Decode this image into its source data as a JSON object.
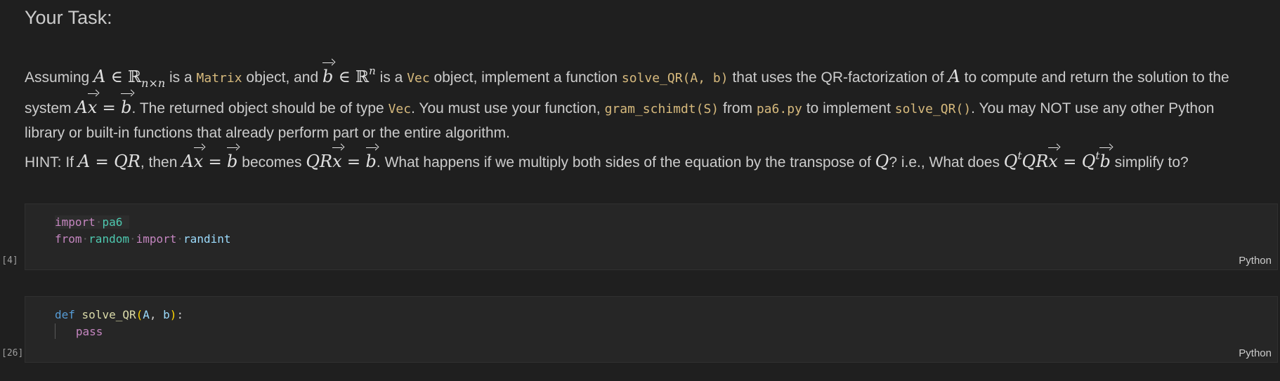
{
  "markdown": {
    "heading": "Your Task:",
    "p1": {
      "t_assuming": "Assuming",
      "t_is_a": "is a",
      "code_matrix": "Matrix",
      "t_object_and": "object, and",
      "t_is_a2": "is a",
      "code_vec": "Vec",
      "t_object_impl": "object, implement a function",
      "code_solve": "solve_QR(A, b)",
      "t_uses": "that uses the QR-factorization of",
      "t_compute": "to compute and return the solution to the",
      "t_system": "system",
      "t_returned": ". The returned object should be of type",
      "code_vec2": "Vec",
      "t_must": ". You must use your function,",
      "code_gram": "gram_schimdt(S)",
      "t_from": "from",
      "code_pa6": "pa6.py",
      "t_to_impl": "to implement",
      "code_solve2": "solve_QR()",
      "t_may_not": ". You may NOT use any other Python",
      "t_library": "library or built-in functions that already perform part or the entire algorithm."
    },
    "p2": {
      "t_hint": "HINT: If",
      "t_then": ", then",
      "t_becomes": "becomes",
      "t_what": ". What happens if we multiply both sides of the equation by the transpose of",
      "t_ie": "? i.e., What does",
      "t_simplify": "simplify to?"
    }
  },
  "cells": [
    {
      "execution_count": "[4]",
      "language": "Python",
      "lines": [
        {
          "kw1": "import",
          "mod": "pa6"
        },
        {
          "kw1": "from",
          "mod": "random",
          "kw2": "import",
          "name": "randint"
        }
      ]
    },
    {
      "execution_count": "[26]",
      "language": "Python",
      "lines": [
        {
          "kw": "def",
          "fn": "solve_QR",
          "open": "(",
          "p1": "A",
          "comma": ", ",
          "p2": "b",
          "close": ")",
          "colon": ":"
        },
        {
          "kw": "pass"
        }
      ]
    }
  ]
}
